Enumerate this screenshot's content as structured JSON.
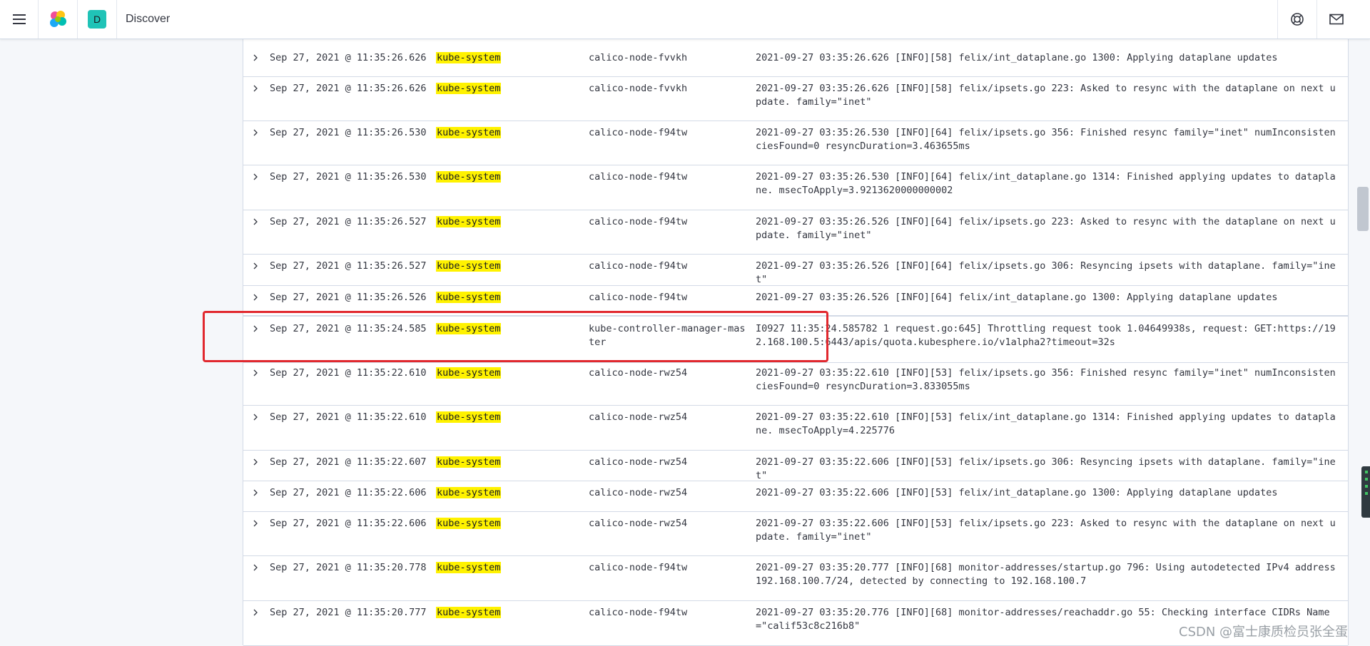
{
  "header": {
    "title": "Discover",
    "space_initial": "D",
    "icons": {
      "menu": "hamburger-menu-icon",
      "logo": "elastic-logo-icon",
      "help": "help-lifebuoy-icon",
      "mail": "mail-icon"
    }
  },
  "colors": {
    "namespace_highlight": "#fff200",
    "space_avatar": "#20c3b7",
    "annotation_box": "#e1282e"
  },
  "table": {
    "rows": [
      {
        "time": "Sep 27, 2021 @ 11:35:26.626",
        "namespace": "kube-system",
        "pod": "calico-node-fvvkh",
        "log": "2021-09-27 03:35:26.626 [INFO][58] felix/int_dataplane.go 1300: Applying dataplane updates"
      },
      {
        "time": "Sep 27, 2021 @ 11:35:26.626",
        "namespace": "kube-system",
        "pod": "calico-node-fvvkh",
        "log": "2021-09-27 03:35:26.626 [INFO][58] felix/ipsets.go 223: Asked to resync with the dataplane on next update. family=\"inet\""
      },
      {
        "time": "Sep 27, 2021 @ 11:35:26.530",
        "namespace": "kube-system",
        "pod": "calico-node-f94tw",
        "log": "2021-09-27 03:35:26.530 [INFO][64] felix/ipsets.go 356: Finished resync family=\"inet\" numInconsistenciesFound=0 resyncDuration=3.463655ms"
      },
      {
        "time": "Sep 27, 2021 @ 11:35:26.530",
        "namespace": "kube-system",
        "pod": "calico-node-f94tw",
        "log": "2021-09-27 03:35:26.530 [INFO][64] felix/int_dataplane.go 1314: Finished applying updates to dataplane. msecToApply=3.9213620000000002"
      },
      {
        "time": "Sep 27, 2021 @ 11:35:26.527",
        "namespace": "kube-system",
        "pod": "calico-node-f94tw",
        "log": "2021-09-27 03:35:26.526 [INFO][64] felix/ipsets.go 223: Asked to resync with the dataplane on next update. family=\"inet\""
      },
      {
        "time": "Sep 27, 2021 @ 11:35:26.527",
        "namespace": "kube-system",
        "pod": "calico-node-f94tw",
        "log": "2021-09-27 03:35:26.526 [INFO][64] felix/ipsets.go 306: Resyncing ipsets with dataplane. family=\"inet\""
      },
      {
        "time": "Sep 27, 2021 @ 11:35:26.526",
        "namespace": "kube-system",
        "pod": "calico-node-f94tw",
        "log": "2021-09-27 03:35:26.526 [INFO][64] felix/int_dataplane.go 1300: Applying dataplane updates"
      },
      {
        "time": "Sep 27, 2021 @ 11:35:24.585",
        "namespace": "kube-system",
        "pod": "kube-controller-manager-master",
        "log": "I0927 11:35:24.585782       1 request.go:645] Throttling request took 1.04649938s, request: GET:https://192.168.100.5:6443/apis/quota.kubesphere.io/v1alpha2?timeout=32s"
      },
      {
        "time": "Sep 27, 2021 @ 11:35:22.610",
        "namespace": "kube-system",
        "pod": "calico-node-rwz54",
        "log": "2021-09-27 03:35:22.610 [INFO][53] felix/ipsets.go 356: Finished resync family=\"inet\" numInconsistenciesFound=0 resyncDuration=3.833055ms"
      },
      {
        "time": "Sep 27, 2021 @ 11:35:22.610",
        "namespace": "kube-system",
        "pod": "calico-node-rwz54",
        "log": "2021-09-27 03:35:22.610 [INFO][53] felix/int_dataplane.go 1314: Finished applying updates to dataplane. msecToApply=4.225776"
      },
      {
        "time": "Sep 27, 2021 @ 11:35:22.607",
        "namespace": "kube-system",
        "pod": "calico-node-rwz54",
        "log": "2021-09-27 03:35:22.606 [INFO][53] felix/ipsets.go 306: Resyncing ipsets with dataplane. family=\"inet\""
      },
      {
        "time": "Sep 27, 2021 @ 11:35:22.606",
        "namespace": "kube-system",
        "pod": "calico-node-rwz54",
        "log": "2021-09-27 03:35:22.606 [INFO][53] felix/int_dataplane.go 1300: Applying dataplane updates"
      },
      {
        "time": "Sep 27, 2021 @ 11:35:22.606",
        "namespace": "kube-system",
        "pod": "calico-node-rwz54",
        "log": "2021-09-27 03:35:22.606 [INFO][53] felix/ipsets.go 223: Asked to resync with the dataplane on next update. family=\"inet\""
      },
      {
        "time": "Sep 27, 2021 @ 11:35:20.778",
        "namespace": "kube-system",
        "pod": "calico-node-f94tw",
        "log": "2021-09-27 03:35:20.777 [INFO][68] monitor-addresses/startup.go 796: Using autodetected IPv4 address 192.168.100.7/24, detected by connecting to 192.168.100.7"
      },
      {
        "time": "Sep 27, 2021 @ 11:35:20.777",
        "namespace": "kube-system",
        "pod": "calico-node-f94tw",
        "log": "2021-09-27 03:35:20.776 [INFO][68] monitor-addresses/reachaddr.go 55: Checking interface CIDRs Name=\"calif53c8c216b8\""
      }
    ]
  },
  "watermark": "CSDN @富士康质检员张全蛋"
}
